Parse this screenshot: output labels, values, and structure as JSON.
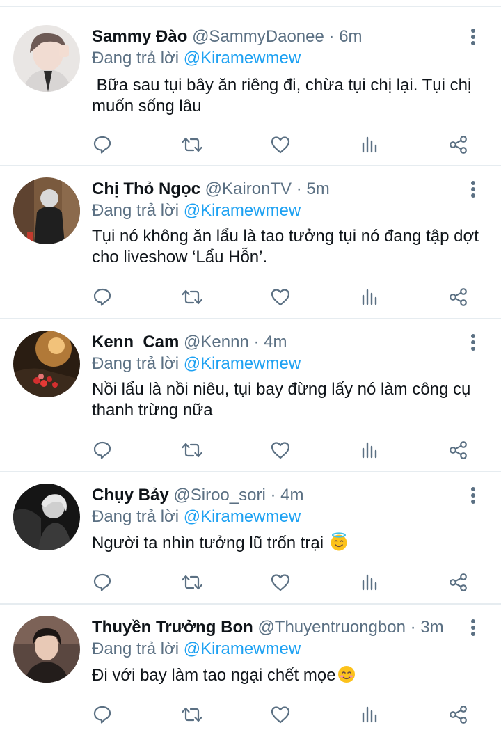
{
  "reply_prefix": "Đang trả lời",
  "tweets": [
    {
      "name": "Sammy Đào",
      "handle": "@SammyDaonee",
      "separator": "·",
      "time": "6m",
      "reply_to": "@Kiramewmew",
      "text": " Bữa sau tụi bây ăn riêng đi, chừa tụi chị lại. Tụi chị muốn sống lâu",
      "emoji": ""
    },
    {
      "name": "Chị Thỏ Ngọc",
      "handle": "@KaironTV",
      "separator": "·",
      "time": "5m",
      "reply_to": "@Kiramewmew",
      "text": "Tụi nó không ăn lẩu là tao tưởng tụi nó đang tập dợt cho liveshow ‘Lẩu Hỗn’.",
      "emoji": ""
    },
    {
      "name": "Kenn_Cam",
      "handle": "@Kennn",
      "separator": "·",
      "time": "4m",
      "reply_to": "@Kiramewmew",
      "text": "Nồi lẩu là nồi niêu, tụi bay đừng lấy nó làm công cụ thanh trừng nữa",
      "emoji": ""
    },
    {
      "name": "Chụy Bảy",
      "handle": "@Siroo_sori",
      "separator": "·",
      "time": "4m",
      "reply_to": "@Kiramewmew",
      "text": "Người ta nhìn tưởng lũ trốn trại ",
      "emoji": "smiling-face-with-halo"
    },
    {
      "name": "Thuyền Trưởng Bon",
      "handle": "@Thuyentruongbon",
      "separator": "·",
      "time": "3m",
      "reply_to": "@Kiramewmew",
      "text": "Đi với bay làm tao ngại chết mọe",
      "emoji": "smiling-face"
    }
  ],
  "colors": {
    "text": "#0f1419",
    "secondary": "#5b7083",
    "mention": "#1da1f2",
    "divider": "#e6ecf0"
  },
  "icons": [
    "reply-icon",
    "retweet-icon",
    "like-icon",
    "analytics-icon",
    "share-icon",
    "more-icon"
  ]
}
